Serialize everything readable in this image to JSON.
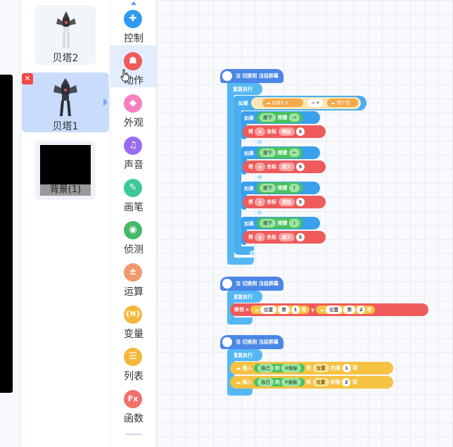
{
  "sprites": {
    "items": [
      {
        "label": "贝塔2",
        "selected": false
      },
      {
        "label": "贝塔1",
        "selected": true
      }
    ],
    "background": {
      "label": "背景(1)"
    },
    "delete_icon": "close-icon"
  },
  "categories": {
    "items": [
      {
        "label": "控制",
        "icon": "gamepad-icon",
        "glyph": "✚",
        "color": "#2f9bf0"
      },
      {
        "label": "动作",
        "icon": "ghost-icon",
        "glyph": "☗",
        "color": "#ef5a5a"
      },
      {
        "label": "外观",
        "icon": "shirt-icon",
        "glyph": "◆",
        "color": "#f77fc0"
      },
      {
        "label": "声音",
        "icon": "music-icon",
        "glyph": "♫",
        "color": "#9a6cf0"
      },
      {
        "label": "画笔",
        "icon": "pen-icon",
        "glyph": "✎",
        "color": "#3ec79a"
      },
      {
        "label": "侦测",
        "icon": "radar-icon",
        "glyph": "◉",
        "color": "#46b96a"
      },
      {
        "label": "运算",
        "icon": "math-icon",
        "glyph": "±",
        "color": "#ef9a6c"
      },
      {
        "label": "变量",
        "icon": "variable-icon",
        "glyph": "{N}",
        "color": "#f5b73b"
      },
      {
        "label": "列表",
        "icon": "list-icon",
        "glyph": "☰",
        "color": "#f5b73b"
      },
      {
        "label": "函数",
        "icon": "function-icon",
        "glyph": "Fx",
        "color": "#f2706a"
      }
    ]
  },
  "script1": {
    "hat": "当 切换到 当前屏幕",
    "forever": "重复执行",
    "if": "如果",
    "cond_left": "玩家1",
    "cond_op": "=",
    "cond_right": "用户名",
    "rows": [
      {
        "if": "如果",
        "press": "按下",
        "key_label": "按键",
        "key": "→",
        "set": "将",
        "axis": "x",
        "coord": "坐标",
        "op": "增加",
        "val": "5"
      },
      {
        "if": "如果",
        "press": "按下",
        "key_label": "按键",
        "key": "←",
        "set": "将",
        "axis": "x",
        "coord": "坐标",
        "op": "减少",
        "val": "5"
      },
      {
        "if": "如果",
        "press": "按下",
        "key_label": "按键",
        "key": "↑",
        "set": "将",
        "axis": "y",
        "coord": "坐标",
        "op": "增加",
        "val": "5"
      },
      {
        "if": "如果",
        "press": "按下",
        "key_label": "按键",
        "key": "↓",
        "set": "将",
        "axis": "y",
        "coord": "坐标",
        "op": "减少",
        "val": "5"
      }
    ]
  },
  "script2": {
    "hat": "当 切换到 当前屏幕",
    "forever": "重复执行",
    "move": "移到 x",
    "pos1": "位置",
    "nth1": "第",
    "n1": "1",
    "item1": "项",
    "y_label": "y",
    "pos2": "位置",
    "nth2": "第",
    "n2": "2",
    "item2": "项"
  },
  "script3": {
    "hat": "当 切换到 当前屏幕",
    "forever": "重复执行",
    "rows": [
      {
        "insert": "插入",
        "self": "自己",
        "of": "的",
        "prop": "X坐标",
        "to": "到",
        "list": "位置",
        "at": "的第",
        "n": "1",
        "item": "项"
      },
      {
        "insert": "插入",
        "self": "自己",
        "of": "的",
        "prop": "Y坐标",
        "to": "到",
        "list": "位置",
        "at": "的第",
        "n": "2",
        "item": "项"
      }
    ]
  }
}
